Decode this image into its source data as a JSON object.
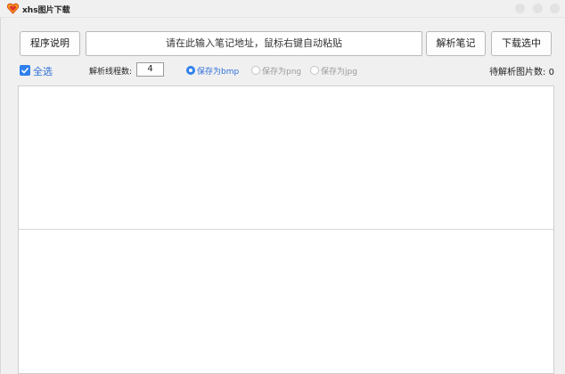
{
  "window": {
    "title": "xhs图片下载",
    "app_icon": "heart-logo-icon",
    "accent_color": "#2f80ed"
  },
  "toolbar": {
    "help_label": "程序说明",
    "url_placeholder": "请在此输入笔记地址，鼠标右键自动粘贴",
    "parse_label": "解析笔记",
    "download_label": "下载选中"
  },
  "options": {
    "select_all_label": "全选",
    "select_all_checked": true,
    "threads_label": "解析线程数:",
    "threads_value": "4",
    "format_options": [
      {
        "label": "保存为bmp",
        "checked": true
      },
      {
        "label": "保存为png",
        "checked": false
      },
      {
        "label": "保存为jpg",
        "checked": false
      }
    ],
    "pending_label": "待解析图片数:",
    "pending_count": "0"
  }
}
